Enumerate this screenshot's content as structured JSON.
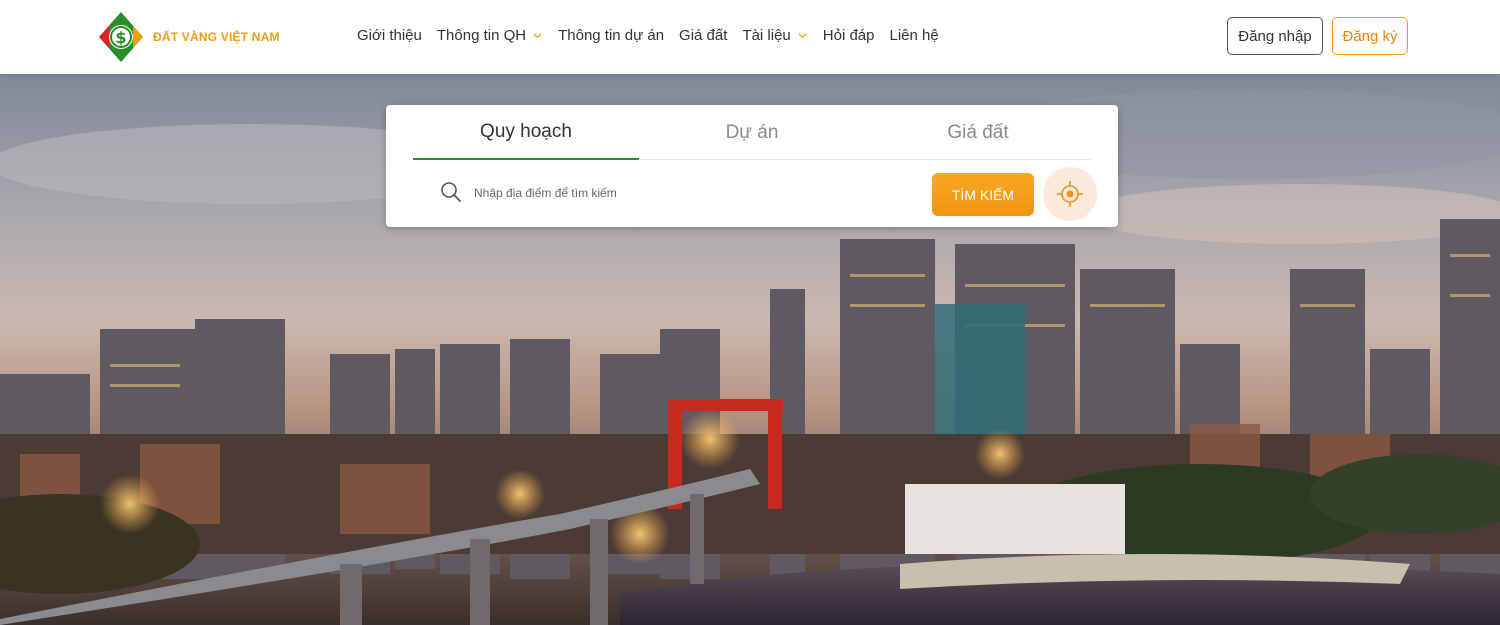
{
  "brand": {
    "name": "ĐẤT VÀNG VIỆT NAM",
    "logo_icon": "dollar-diamond-logo",
    "colors": {
      "green": "#2a8d2a",
      "orange": "#f39a18",
      "red": "#d9262b"
    }
  },
  "nav": {
    "items": [
      {
        "label": "Giới thiệu",
        "dropdown": false
      },
      {
        "label": "Thông tin QH",
        "dropdown": true
      },
      {
        "label": "Thông tin dự án",
        "dropdown": false
      },
      {
        "label": "Giá đất",
        "dropdown": false
      },
      {
        "label": "Tài liệu",
        "dropdown": true
      },
      {
        "label": "Hỏi đáp",
        "dropdown": false
      },
      {
        "label": "Liên hệ",
        "dropdown": false
      }
    ]
  },
  "auth": {
    "login_label": "Đăng nhập",
    "register_label": "Đăng ký"
  },
  "search": {
    "tabs": [
      {
        "label": "Quy hoạch",
        "active": true
      },
      {
        "label": "Dự án",
        "active": false
      },
      {
        "label": "Giá đất",
        "active": false
      }
    ],
    "placeholder": "Nhập địa điểm để tìm kiếm",
    "button_label": "TÌM KIẾM",
    "icons": {
      "search": "search-icon",
      "locate": "locate-icon"
    },
    "accent": "#f39a18",
    "tab_accent": "#2e8b3a"
  },
  "hero": {
    "image": "hanoi-city-skyline-dusk"
  }
}
